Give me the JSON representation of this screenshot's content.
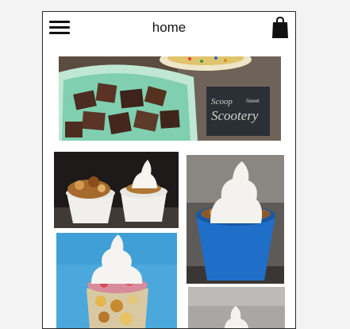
{
  "header": {
    "title": "home",
    "menu_icon": "hamburger-menu-icon",
    "cart_icon": "shopping-bag-icon"
  },
  "photos": [
    {
      "id": "ice-cream-bowl-brownies",
      "sign_line1": "Scoop",
      "sign_line2": "Scootery",
      "sign_small": "Sweet"
    },
    {
      "id": "sundae-cups"
    },
    {
      "id": "blue-cup-soft-serve"
    },
    {
      "id": "parfait-glass"
    },
    {
      "id": "soft-serve-partial"
    }
  ],
  "colors": {
    "frame": "#2a2a2a",
    "sign_bg": "#2b3037",
    "sign_text": "#c9d6c6",
    "cup_blue": "#1f6fc9",
    "sky_blue": "#4aa8dc"
  }
}
